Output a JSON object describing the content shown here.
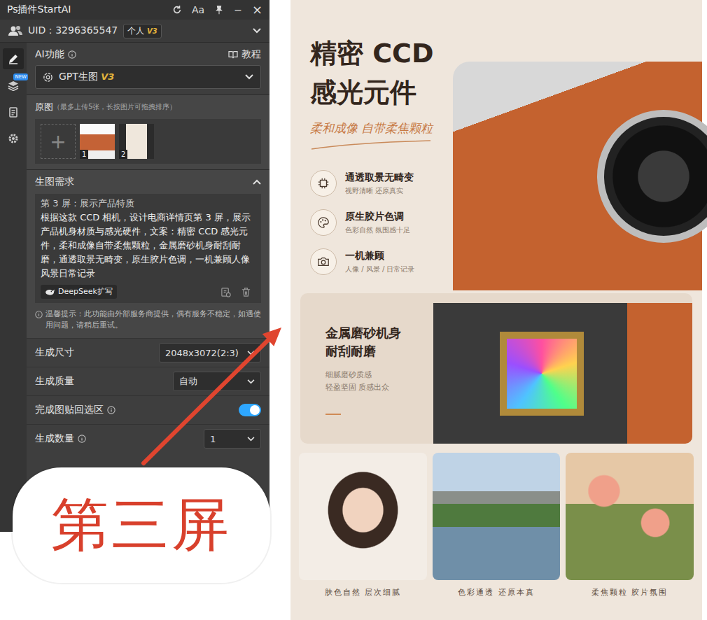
{
  "title_bar": {
    "title": "Ps插件StartAI",
    "font_button": "Aa",
    "minimize": "−",
    "close": "×"
  },
  "user": {
    "uid": "UID：3296365547",
    "plan": "个人",
    "version": "V3"
  },
  "nav": [
    {
      "selected": true,
      "badge": ""
    },
    {
      "selected": false,
      "badge": "NEW"
    },
    {
      "selected": false,
      "badge": ""
    },
    {
      "selected": false,
      "badge": ""
    }
  ],
  "ai_function": {
    "label": "AI功能",
    "tutorial": "教程",
    "model": "GPT生图",
    "model_version": "V3"
  },
  "source_images": {
    "label": "原图",
    "hint": "（最多上传5张，长按图片可拖拽排序）",
    "add": "+",
    "thumbs": [
      "1",
      "2"
    ]
  },
  "prompt": {
    "label": "生图需求",
    "expanded": true,
    "cut_line": "第 3 屏：展示产品特质",
    "text": "根据这款 CCD 相机，设计电商详情页第 3 屏，展示产品机身材质与感光硬件，文案：精密 CCD 感光元件，柔和成像自带柔焦颗粒，金属磨砂机身耐刮耐磨，通透取景无畸变，原生胶片色调，一机兼顾人像风景日常记录",
    "expand_button": "DeepSeek扩写"
  },
  "notice": "温馨提示：此功能由外部服务商提供，偶有服务不稳定，如遇使用问题，请稍后重试。",
  "settings": [
    {
      "kind": "select",
      "label": "生成尺寸",
      "info": false,
      "value": "2048x3072(2:3)"
    },
    {
      "kind": "select",
      "label": "生成质量",
      "info": false,
      "value": "自动"
    },
    {
      "kind": "toggle",
      "label": "完成图贴回选区",
      "info": true,
      "on": true
    },
    {
      "kind": "select",
      "label": "生成数量",
      "info": true,
      "value": "1"
    }
  ],
  "callout": "第三屏",
  "poster": {
    "title": [
      "精密 CCD",
      "感光元件"
    ],
    "tagline": "柔和成像 自带柔焦颗粒",
    "features": [
      {
        "title": "通透取景无畸变",
        "sub": "视野清晰 还原真实"
      },
      {
        "title": "原生胶片色调",
        "sub": "色彩自然 氛围感十足"
      },
      {
        "title": "一机兼顾",
        "sub": "人像 / 风景 / 日常记录"
      }
    ],
    "detail": {
      "title": [
        "金属磨砂机身",
        "耐刮耐磨"
      ],
      "lines": [
        "细腻磨砂质感",
        "轻盈坚固 质感出众"
      ]
    },
    "gallery": [
      {
        "caption": "肤色自然 层次细腻"
      },
      {
        "caption": "色彩通透 还原本真"
      },
      {
        "caption": "柔焦颗粒 胶片氛围"
      }
    ]
  }
}
